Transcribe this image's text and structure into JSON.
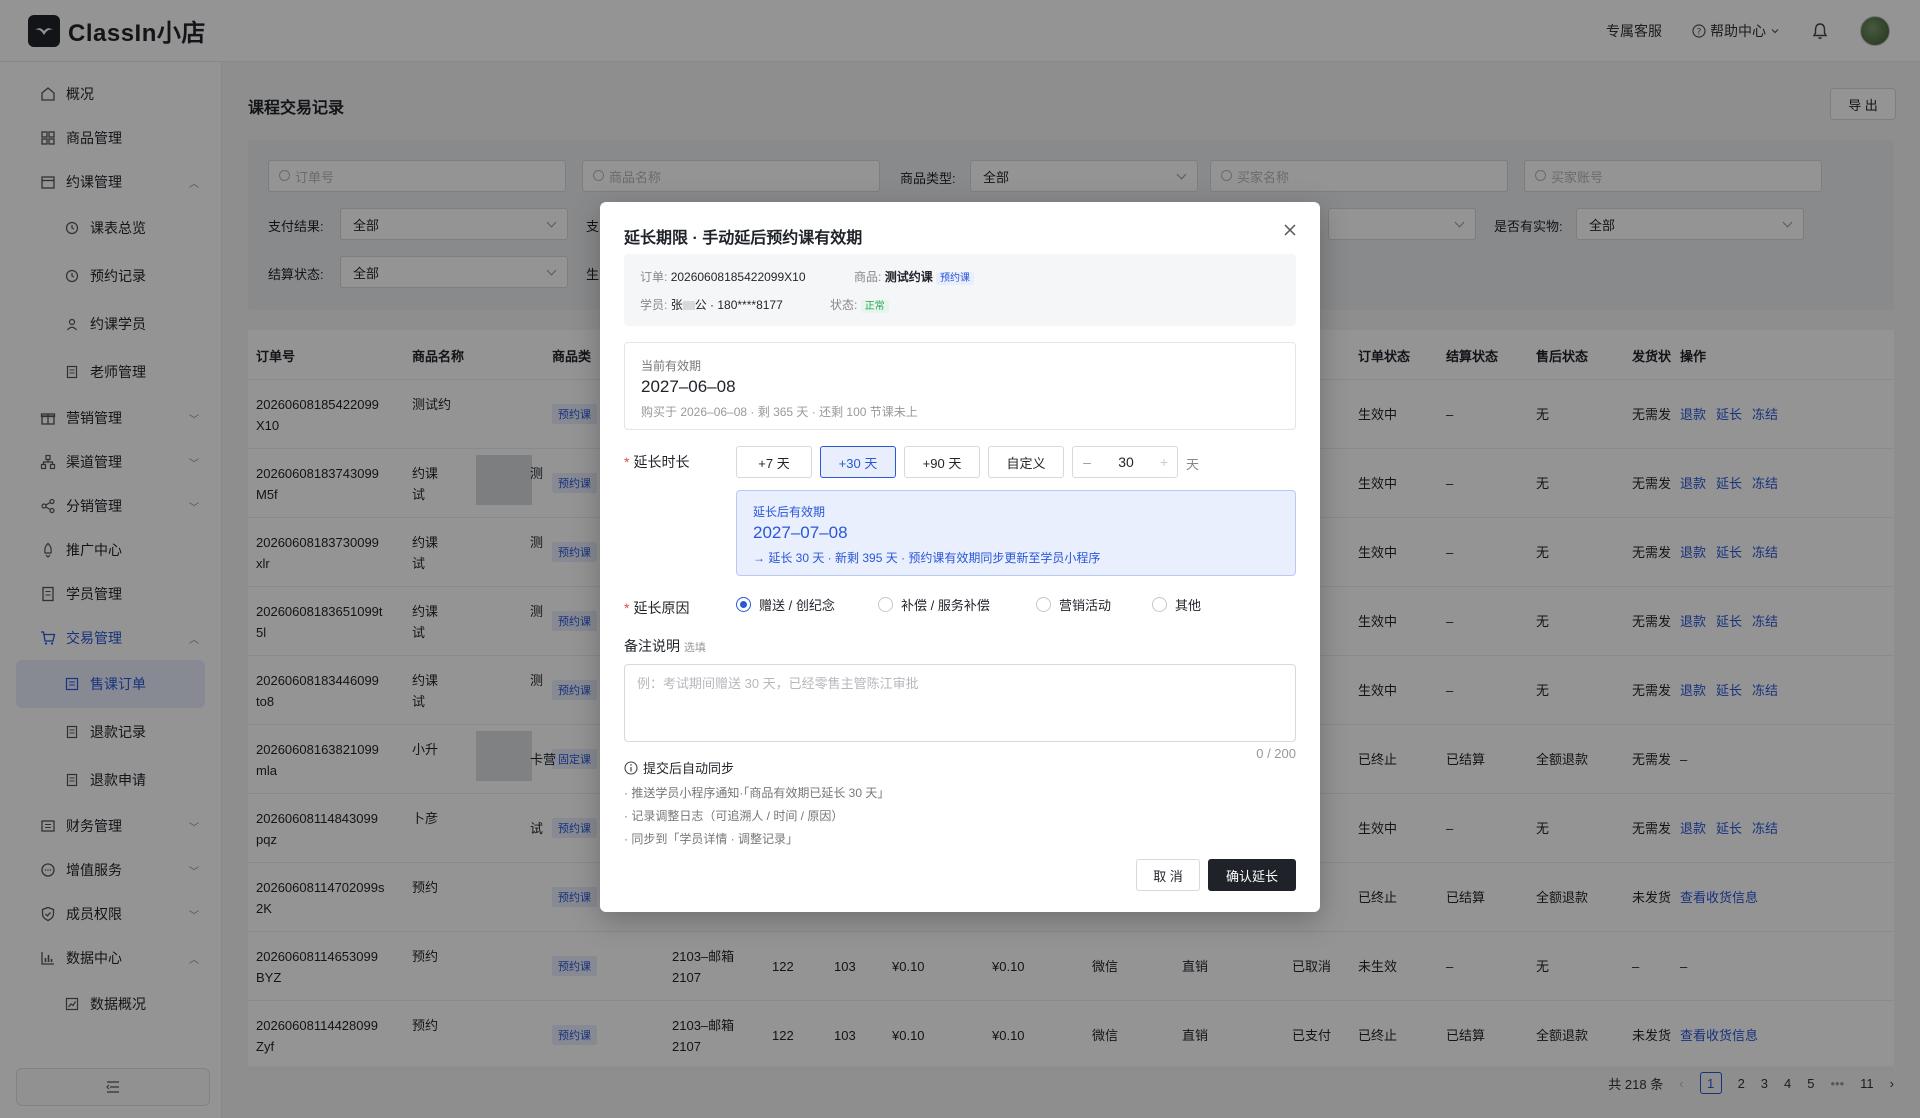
{
  "app": {
    "logo": "ClassIn小店",
    "support": "专属客服",
    "help": "帮助中心"
  },
  "sidebar": {
    "items": [
      {
        "label": "概况"
      },
      {
        "label": "商品管理"
      },
      {
        "label": "约课管理"
      },
      {
        "label": "课表总览"
      },
      {
        "label": "预约记录"
      },
      {
        "label": "约课学员"
      },
      {
        "label": "老师管理"
      },
      {
        "label": "营销管理"
      },
      {
        "label": "渠道管理"
      },
      {
        "label": "分销管理"
      },
      {
        "label": "推广中心"
      },
      {
        "label": "学员管理"
      },
      {
        "label": "交易管理"
      },
      {
        "label": "售课订单"
      },
      {
        "label": "退款记录"
      },
      {
        "label": "退款申请"
      },
      {
        "label": "财务管理"
      },
      {
        "label": "增值服务"
      },
      {
        "label": "成员权限"
      },
      {
        "label": "数据中心"
      },
      {
        "label": "数据概况"
      }
    ]
  },
  "main": {
    "title": "课程交易记录",
    "export": "导 出",
    "filters": {
      "order_no_ph": "订单号",
      "product_name_ph": "商品名称",
      "product_type_label": "商品类型:",
      "product_type_val": "全部",
      "buyer_name_ph": "买家名称",
      "buyer_account_ph": "买家账号",
      "pay_result_label": "支付结果:",
      "pay_result_val": "全部",
      "pay_cut": "支",
      "physical_label": "是否有实物:",
      "physical_val": "全部",
      "settle_label": "结算状态:",
      "settle_val": "全部",
      "settle_cut": "生"
    },
    "columns": [
      "订单号",
      "商品名称",
      "商品类",
      "订单状态",
      "结算状态",
      "售后状态",
      "发货状",
      "操作"
    ],
    "rows": [
      {
        "id1": "20260608185422099",
        "id2": "X10",
        "name1": "测试约",
        "name2": "",
        "tag": "预约课",
        "order": "生效中",
        "settle": "–",
        "after": "无",
        "ship": "无需发",
        "ops": [
          "退款",
          "延长",
          "冻结"
        ]
      },
      {
        "id1": "20260608183743099",
        "id2": "M5f",
        "name1": "约课",
        "name2": "试",
        "tag": "预约课",
        "order": "生效中",
        "settle": "–",
        "after": "无",
        "ship": "无需发",
        "ops": [
          "退款",
          "延长",
          "冻结"
        ]
      },
      {
        "id1": "20260608183730099",
        "id2": "xlr",
        "name1": "约课",
        "name2": "试",
        "tag": "预约课",
        "order": "生效中",
        "settle": "–",
        "after": "无",
        "ship": "无需发",
        "ops": [
          "退款",
          "延长",
          "冻结"
        ]
      },
      {
        "id1": "20260608183651099t",
        "id2": "5l",
        "name1": "约课",
        "name2": "试",
        "tag": "预约课",
        "order": "生效中",
        "settle": "–",
        "after": "无",
        "ship": "无需发",
        "ops": [
          "退款",
          "延长",
          "冻结"
        ]
      },
      {
        "id1": "20260608183446099",
        "id2": "to8",
        "name1": "约课",
        "name2": "试",
        "tag": "预约课",
        "order": "生效中",
        "settle": "–",
        "after": "无",
        "ship": "无需发",
        "ops": [
          "退款",
          "延长",
          "冻结"
        ]
      },
      {
        "id1": "20260608163821099",
        "id2": "mla",
        "name1": "小升",
        "name2": "",
        "tag": "固定课",
        "order": "已终止",
        "settle": "已结算",
        "after": "全额退款",
        "ship": "无需发",
        "ops": [
          "–"
        ]
      },
      {
        "id1": "20260608114843099",
        "id2": "pqz",
        "name1": "卜彦",
        "name2": "",
        "tag": "预约课",
        "order": "生效中",
        "settle": "–",
        "after": "无",
        "ship": "无需发",
        "ops": [
          "退款",
          "延长",
          "冻结"
        ]
      },
      {
        "id1": "20260608114702099s",
        "id2": "2K",
        "name1": "预约",
        "name2": "",
        "tag": "预约课",
        "order": "已终止",
        "settle": "已结算",
        "after": "全额退款",
        "ship": "未发货",
        "ops": [
          "查看收货信息"
        ]
      },
      {
        "id1": "20260608114653099",
        "id2": "BYZ",
        "name1": "预约",
        "name2": "",
        "tag": "预约课",
        "order": "未生效",
        "settle": "–",
        "after": "无",
        "ship": "–",
        "ops": [
          "–"
        ]
      },
      {
        "id1": "20260608114428099",
        "id2": "Zyf",
        "name1": "预约",
        "name2": "",
        "tag": "预约课",
        "order": "已终止",
        "settle": "已结算",
        "after": "全额退款",
        "ship": "未发货",
        "ops": [
          "查看收货信息"
        ]
      }
    ],
    "row_extra": {
      "mail": "2103–邮箱",
      "mail2": "2107",
      "q1": "122",
      "q2": "103",
      "p1": "¥0.10",
      "p2": "¥0.10",
      "pay": "微信",
      "channel": "直销",
      "status_cancel": "已取消",
      "status_paid": "已支付"
    },
    "frag": {
      "a": "测",
      "b": "卡营",
      "c": "试"
    },
    "pagination": {
      "total": "共 218 条",
      "pages": [
        "1",
        "2",
        "3",
        "4",
        "5",
        "•••",
        "11"
      ]
    }
  },
  "modal": {
    "title": "延长期限 · 手动延后预约课有效期",
    "order_k": "订单:",
    "order_v": "20260608185422099X10",
    "product_k": "商品:",
    "product_v": "测试约课",
    "product_tag": "预约课",
    "student_k": "学员:",
    "student_v": "张",
    "student_v2": "公 · 180****8177",
    "status_k": "状态:",
    "status_tag": "正常",
    "current_label": "当前有效期",
    "current_date": "2027–06–08",
    "current_sub": "购买于 2026–06–08 · 剩 365 天 · 还剩 100 节课未上",
    "duration_label": "延长时长",
    "options": [
      "+7 天",
      "+30 天",
      "+90 天",
      "自定义"
    ],
    "stepper_minus": "–",
    "stepper_value": "30",
    "stepper_plus": "+",
    "unit": "天",
    "after_label": "延长后有效期",
    "after_date": "2027–07–08",
    "after_sub": "→ 延长 30 天 · 新剩 395 天 · 预约课有效期同步更新至学员小程序",
    "reason_label": "延长原因",
    "reasons": [
      "赠送 / 创纪念",
      "补偿 / 服务补偿",
      "营销活动",
      "其他"
    ],
    "note_label": "备注说明",
    "note_opt": "选填",
    "note_ph": "例：考试期间赠送 30 天，已经零售主管陈江审批",
    "count": "0 / 200",
    "sync_title": "提交后自动同步",
    "sync_items": [
      "· 推送学员小程序通知·「商品有效期已延长 30 天」",
      "· 记录调整日志（可追溯人 / 时间 / 原因）",
      "· 同步到「学员详情 · 调整记录」"
    ],
    "cancel": "取 消",
    "confirm": "确认延长"
  }
}
